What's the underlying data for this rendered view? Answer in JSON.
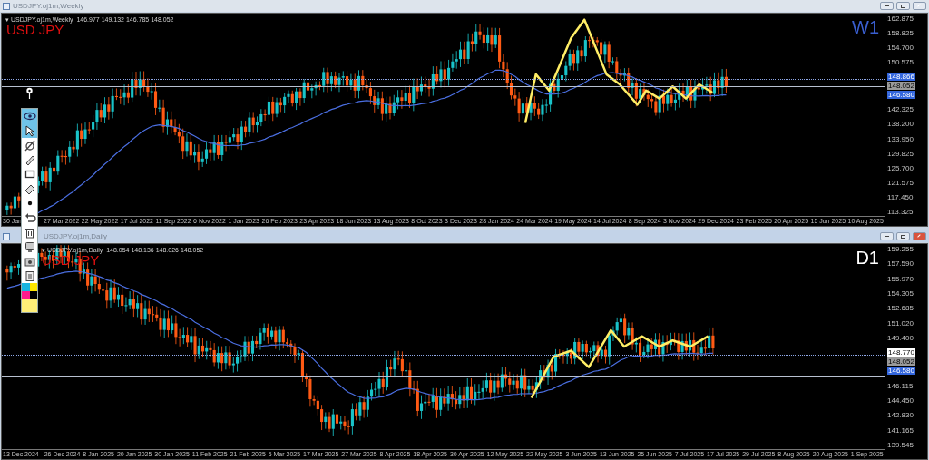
{
  "windows": [
    {
      "title": "USDJPY.oj1m,Weekly",
      "active": false,
      "info": "▾ USDJPY.oj1m,Weekly  146.977 149.132 146.785 148.052",
      "symbol_label": "USD JPY",
      "timeframe": "W1",
      "price_ticks": [
        "162.875",
        "158.825",
        "154.700",
        "150.575",
        "142.325",
        "138.200",
        "133.950",
        "129.825",
        "125.700",
        "121.575",
        "117.450",
        "113.325"
      ],
      "price_tags": [
        {
          "text": "148.866",
          "color": "#3366dd"
        },
        {
          "text": "148.052",
          "color": "#9a9a9a"
        },
        {
          "text": "146.580",
          "color": "#3366dd"
        }
      ],
      "dates": [
        "30 Jan",
        "27 Mar 2022",
        "22 May 2022",
        "17 Jul 2022",
        "11 Sep 2022",
        "6 Nov 2022",
        "1 Jan 2023",
        "26 Feb 2023",
        "23 Apr 2023",
        "18 Jun 2023",
        "13 Aug 2023",
        "8 Oct 2023",
        "3 Dec 2023",
        "28 Jan 2024",
        "24 Mar 2024",
        "19 May 2024",
        "14 Jul 2024",
        "8 Sep 2024",
        "3 Nov 2024",
        "29 Dec 2024",
        "23 Feb 2025",
        "20 Apr 2025",
        "15 Jun 2025",
        "10 Aug 2025"
      ]
    },
    {
      "title": "USDJPY.oj1m,Daily",
      "active": true,
      "info": "▾ USDJPY.oj1m,Daily  148.054 148.136 148.026 148.052",
      "symbol_label": "USD JPY",
      "timeframe": "D1",
      "price_ticks": [
        "159.255",
        "157.590",
        "155.970",
        "154.305",
        "152.685",
        "151.020",
        "149.400",
        "146.115",
        "144.450",
        "142.830",
        "141.165",
        "139.545"
      ],
      "price_tags": [
        {
          "text": "148.770",
          "color": "#ffffff"
        },
        {
          "text": "148.052",
          "color": "#9a9a9a"
        },
        {
          "text": "146.580",
          "color": "#3366dd"
        }
      ],
      "dates": [
        "13 Dec 2024",
        "26 Dec 2024",
        "8 Jan 2025",
        "20 Jan 2025",
        "30 Jan 2025",
        "11 Feb 2025",
        "21 Feb 2025",
        "5 Mar 2025",
        "17 Mar 2025",
        "27 Mar 2025",
        "8 Apr 2025",
        "18 Apr 2025",
        "30 Apr 2025",
        "12 May 2025",
        "22 May 2025",
        "3 Jun 2025",
        "13 Jun 2025",
        "25 Jun 2025",
        "7 Jul 2025",
        "17 Jul 2025",
        "29 Jul 2025",
        "8 Aug 2025",
        "20 Aug 2025",
        "1 Sep 2025"
      ]
    }
  ],
  "toolbar": {
    "tools": [
      {
        "selected": true
      },
      {
        "selected": true
      },
      {
        "selected": false
      },
      {
        "selected": false
      },
      {
        "selected": false
      },
      {
        "selected": false
      },
      {
        "selected": false
      },
      {
        "selected": false
      },
      {
        "selected": false
      },
      {
        "selected": false
      },
      {
        "selected": false
      },
      {
        "selected": false
      }
    ],
    "swatches": [
      {
        "color": "#19b4e0"
      },
      {
        "color": "#ffe600"
      },
      {
        "color": "#ff1a8c"
      },
      {
        "color": "#000000"
      }
    ],
    "current_swatch": {
      "color": "#ffee77"
    }
  }
}
